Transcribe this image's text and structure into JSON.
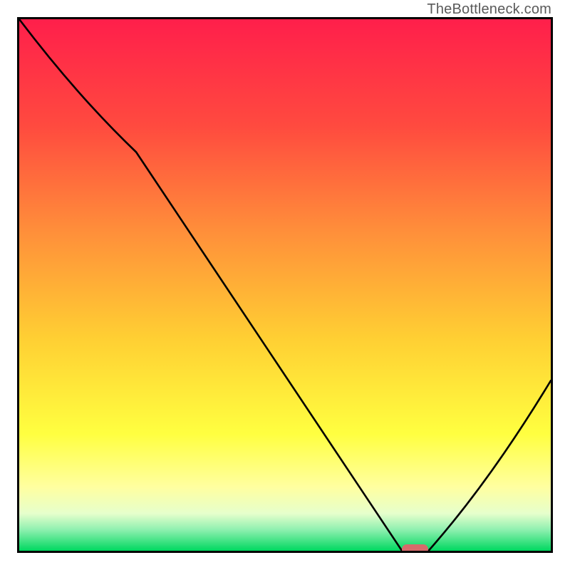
{
  "watermark": "TheBottleneck.com",
  "chart_data": {
    "type": "line",
    "title": "",
    "xlabel": "",
    "ylabel": "",
    "xlim": [
      0,
      100
    ],
    "ylim": [
      0,
      100
    ],
    "grid": false,
    "legend": false,
    "series": [
      {
        "name": "bottleneck-curve",
        "x": [
          0,
          22,
          72,
          77,
          100
        ],
        "values": [
          100,
          75,
          0,
          0,
          32
        ]
      }
    ],
    "background_gradient_stops": [
      {
        "pos": 0.0,
        "color": "#ff1f4b"
      },
      {
        "pos": 0.2,
        "color": "#ff4a3f"
      },
      {
        "pos": 0.4,
        "color": "#ff8f3a"
      },
      {
        "pos": 0.6,
        "color": "#ffcf33"
      },
      {
        "pos": 0.78,
        "color": "#ffff40"
      },
      {
        "pos": 0.88,
        "color": "#ffffa0"
      },
      {
        "pos": 0.93,
        "color": "#e6ffcc"
      },
      {
        "pos": 0.96,
        "color": "#90f0b0"
      },
      {
        "pos": 1.0,
        "color": "#00d860"
      }
    ],
    "marker": {
      "name": "optimal-zone",
      "x_center": 74.5,
      "y": 0,
      "width_pct": 5,
      "color": "#d66b6b"
    }
  }
}
